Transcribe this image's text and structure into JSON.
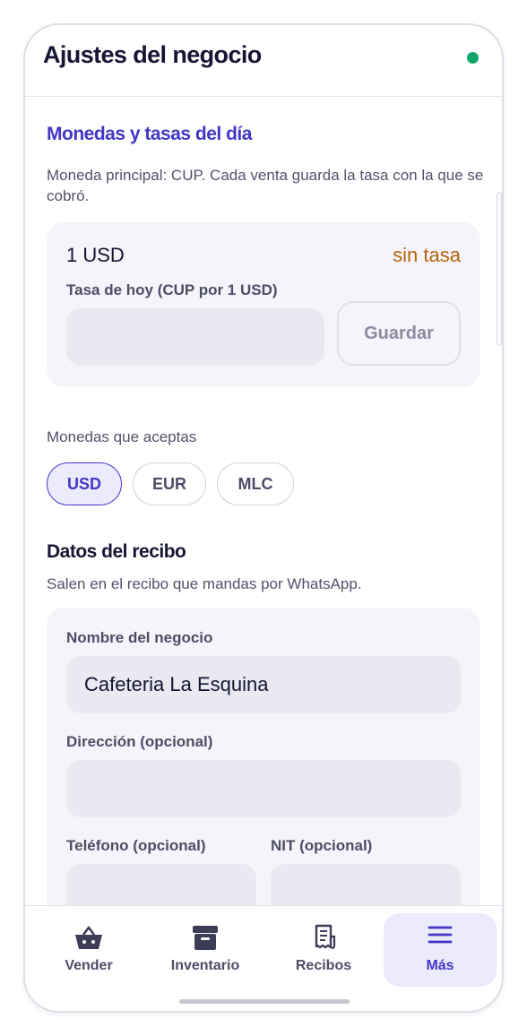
{
  "header": {
    "title": "Ajustes del negocio",
    "status_color": "#12a56a"
  },
  "currency_section": {
    "title": "Monedas y tasas del día",
    "description": "Moneda principal: CUP. Cada venta guarda la tasa con la que se cobró.",
    "rate_card": {
      "currency": "1 USD",
      "status": "sin tasa",
      "rate_label": "Tasa de hoy (CUP por 1 USD)",
      "rate_value": "",
      "save_label": "Guardar"
    },
    "accepted_label": "Monedas que aceptas",
    "chips": [
      {
        "label": "USD",
        "selected": true
      },
      {
        "label": "EUR",
        "selected": false
      },
      {
        "label": "MLC",
        "selected": false
      }
    ]
  },
  "receipt_section": {
    "title": "Datos del recibo",
    "description": "Salen en el recibo que mandas por WhatsApp.",
    "fields": {
      "business_name_label": "Nombre del negocio",
      "business_name_value": "Cafeteria La Esquina",
      "address_label": "Dirección (opcional)",
      "address_value": "",
      "phone_label": "Teléfono (opcional)",
      "phone_value": "",
      "nit_label": "NIT (opcional)",
      "nit_value": ""
    }
  },
  "tabbar": {
    "items": [
      {
        "label": "Vender",
        "icon": "basket-icon",
        "active": false
      },
      {
        "label": "Inventario",
        "icon": "archive-box-icon",
        "active": false
      },
      {
        "label": "Recibos",
        "icon": "receipt-icon",
        "active": false
      },
      {
        "label": "Más",
        "icon": "menu-icon",
        "active": true
      }
    ]
  },
  "colors": {
    "accent": "#4236c5",
    "warning_text": "#b76408",
    "card_bg": "#f4f4fa",
    "input_bg": "#e9e9f2"
  }
}
